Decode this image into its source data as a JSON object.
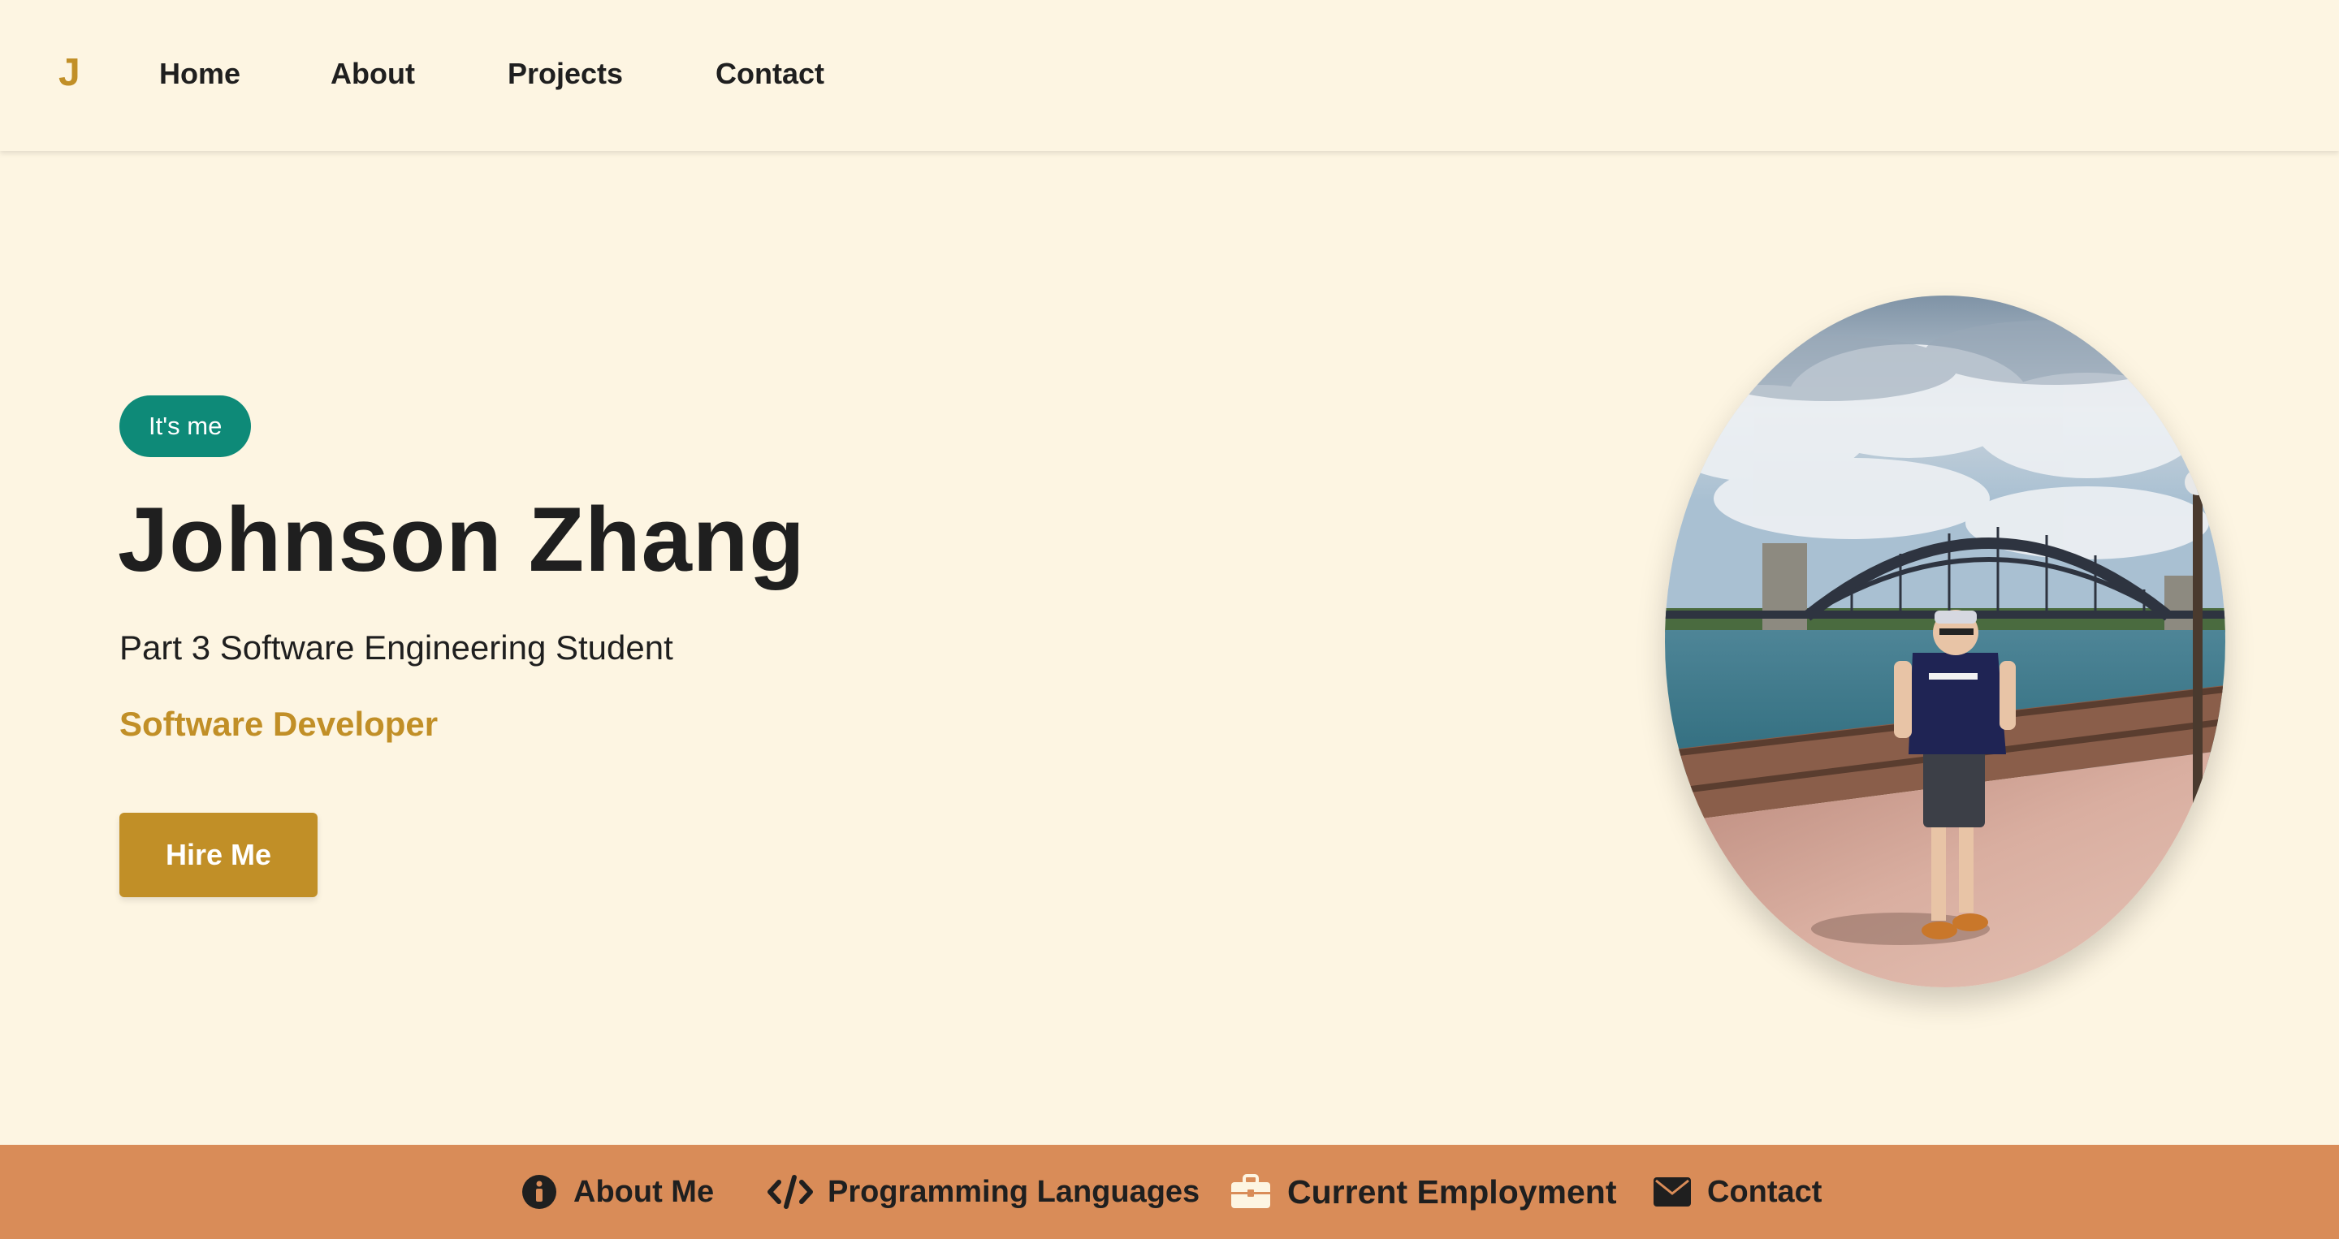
{
  "brand": {
    "logo": "J",
    "accent": "#c18f27"
  },
  "nav": {
    "items": [
      {
        "label": "Home"
      },
      {
        "label": "About"
      },
      {
        "label": "Projects"
      },
      {
        "label": "Contact"
      }
    ]
  },
  "hero": {
    "badge": "It's me",
    "name": "Johnson Zhang",
    "subtitle": "Part 3 Software Engineering Student",
    "role": "Software Developer",
    "cta": "Hire Me",
    "photo_icon": "profile-photo-sydney-harbour-bridge"
  },
  "footer": {
    "background": "#d98c58",
    "items": [
      {
        "label": "About Me",
        "icon": "info-circle-icon"
      },
      {
        "label": "Programming Languages",
        "icon": "code-icon"
      },
      {
        "label": "Current Employment",
        "icon": "briefcase-icon"
      },
      {
        "label": "Contact",
        "icon": "envelope-icon"
      }
    ]
  },
  "colors": {
    "page_bg": "#fdf5e2",
    "badge_bg": "#0e8a78",
    "text": "#1f1f1f"
  }
}
